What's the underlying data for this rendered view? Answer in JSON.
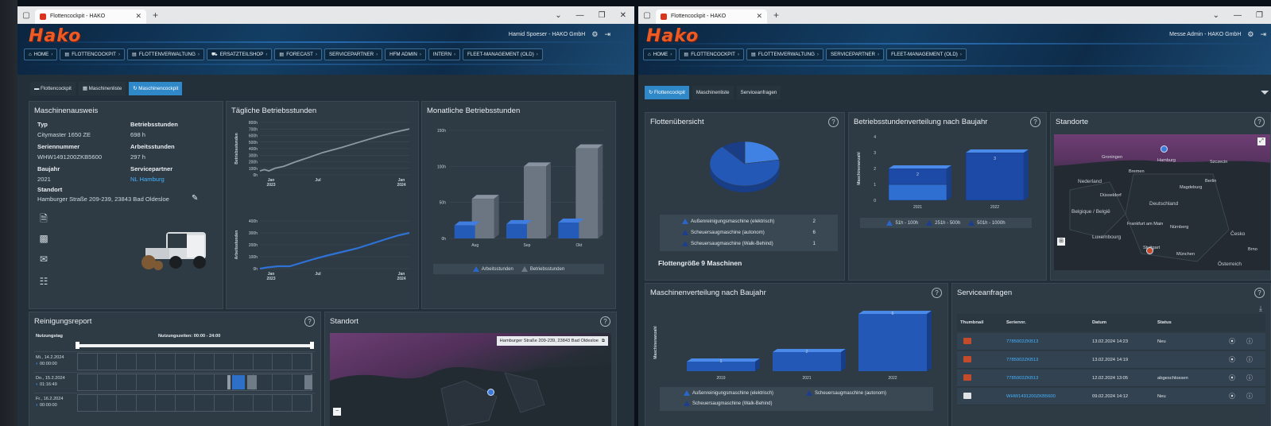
{
  "left": {
    "tab_title": "Flottencockpit - HAKO",
    "logo": "Hako",
    "user": "Hamid Spoeser - HAKO GmbH",
    "nav": [
      "HOME",
      "FLOTTENCOCKPIT",
      "FLOTTENVERWALTUNG",
      "ERSATZTEILSHOP",
      "FORECAST",
      "SERVICEPARTNER",
      "HFM ADMIN",
      "INTERN",
      "FLEET-MANAGEMENT (OLD)"
    ],
    "subtabs": [
      "Flottencockpit",
      "Maschinenliste",
      "Maschinencockpit"
    ],
    "ausweis": {
      "title": "Maschinenausweis",
      "typ_label": "Typ",
      "typ": "Citymaster 1650 ZE",
      "bs_label": "Betriebsstunden",
      "bs": "698 h",
      "sn_label": "Seriennummer",
      "sn": "WHW1491200ZKB5600",
      "as_label": "Arbeitsstunden",
      "as": "297 h",
      "bj_label": "Baujahr",
      "bj": "2021",
      "sp_label": "Servicepartner",
      "sp": "NL Hamburg",
      "st_label": "Standort",
      "st": "Hamburger Straße 209-239, 23843 Bad Oldesloe"
    },
    "taeglich": {
      "title": "Tägliche Betriebsstunden",
      "ylabel1": "Betriebsstunden",
      "ylabel2": "Arbeitsstunden",
      "xt": [
        "Jan\n2023",
        "Jul",
        "Jan\n2023",
        "Jul",
        "Jan\n2024"
      ]
    },
    "monatlich": {
      "title": "Monatliche Betriebsstunden",
      "legend": [
        "Arbeitsstunden",
        "Betriebsstunden"
      ]
    },
    "report": {
      "title": "Reinigungsreport",
      "col1": "Nutzungstag",
      "col2": "Nutzungszeiten: 00:00 - 24:00",
      "rows": [
        {
          "day": "Mi., 14.2.2024",
          "time": "00:00:00"
        },
        {
          "day": "Do., 15.2.2024",
          "time": "01:16:49"
        },
        {
          "day": "Fr., 16.2.2024",
          "time": "00:00:00"
        }
      ]
    },
    "standort": {
      "title": "Standort",
      "address": "Hamburger Straße 209-239, 23843 Bad Oldesloe"
    }
  },
  "right": {
    "tab_title": "Flottencockpit - HAKO",
    "logo": "Hako",
    "user": "Messe Admin - HAKO GmbH",
    "nav": [
      "HOME",
      "FLOTTENCOCKPIT",
      "FLOTTENVERWALTUNG",
      "SERVICEPARTNER",
      "FLEET-MANAGEMENT (OLD)"
    ],
    "subtabs": [
      "Flottencockpit",
      "Maschinenliste",
      "Serviceanfragen"
    ],
    "overview": {
      "title": "Flottenübersicht",
      "items": [
        {
          "label": "Außenreinigungsmaschine (elektrisch)",
          "count": "2"
        },
        {
          "label": "Scheuersaugmaschine (autonom)",
          "count": "6"
        },
        {
          "label": "Scheuersaugmaschine (Walk-Behind)",
          "count": "1"
        }
      ],
      "fleet_size": "Flottengröße 9 Maschinen"
    },
    "bsv": {
      "title": "Betriebsstundenverteilung nach Baujahr",
      "ylabel": "Maschinenanzahl",
      "legend": [
        "51h - 100h",
        "251h - 500h",
        "501h - 1000h"
      ]
    },
    "standorte": {
      "title": "Standorte"
    },
    "mvb": {
      "title": "Maschinenverteilung nach Baujahr",
      "ylabel": "Maschinenanzahl",
      "legend": [
        "Außenreinigungsmaschine (elektrisch)",
        "Scheuersaugmaschine (autonom)",
        "Scheuersaugmaschine (Walk-Behind)"
      ]
    },
    "service": {
      "title": "Serviceanfragen",
      "headers": [
        "Thumbnail",
        "Seriennr.",
        "Datum",
        "Status"
      ],
      "rows": [
        {
          "sn": "7785002ZKB13",
          "date": "13.02.2024 14:23",
          "status": "Neu"
        },
        {
          "sn": "7785002ZKB13",
          "date": "13.02.2024 14:19",
          "status": ""
        },
        {
          "sn": "7785002ZKB13",
          "date": "12.02.2024 13:05",
          "status": "abgeschlossen"
        },
        {
          "sn": "WHW1491200ZKB5600",
          "date": "09.02.2024 14:12",
          "status": "Neu"
        }
      ]
    },
    "map_labels": {
      "countries": [
        "Nederland",
        "Belgique / België",
        "Luxembourg",
        "Deutschland",
        "Česko",
        "Österreich"
      ],
      "cities": [
        "Groningen",
        "Hamburg",
        "Szczecin",
        "Bremen",
        "Berlin",
        "Magdeburg",
        "Düsseldorf",
        "Frankfurt am Main",
        "Nürnberg",
        "Stuttgart",
        "München",
        "Brno"
      ]
    }
  },
  "chart_data": [
    {
      "type": "line",
      "title": "Tägliche Betriebsstunden",
      "ylabel": "Betriebsstunden",
      "yticks": [
        "0h",
        "100h",
        "200h",
        "300h",
        "400h",
        "500h",
        "600h",
        "700h",
        "800h"
      ],
      "xticks": [
        "Jan 2023",
        "Jul",
        "Jan 2024"
      ],
      "ylim": [
        0,
        800
      ],
      "series": [
        {
          "name": "Betriebsstunden",
          "x": [
            0,
            0.03,
            0.06,
            0.1,
            0.16,
            0.24,
            0.32,
            0.42,
            0.55,
            0.68,
            0.8,
            0.9,
            1
          ],
          "y": [
            60,
            80,
            60,
            100,
            130,
            200,
            260,
            340,
            420,
            510,
            590,
            650,
            700
          ]
        }
      ]
    },
    {
      "type": "line",
      "ylabel": "Arbeitsstunden",
      "yticks": [
        "0h",
        "100h",
        "200h",
        "300h",
        "400h"
      ],
      "xticks": [
        "Jan 2023",
        "Jul",
        "Jan 2024"
      ],
      "ylim": [
        0,
        400
      ],
      "series": [
        {
          "name": "Arbeitsstunden",
          "x": [
            0,
            0.05,
            0.12,
            0.2,
            0.28,
            0.36,
            0.45,
            0.55,
            0.65,
            0.75,
            0.85,
            0.93,
            1
          ],
          "y": [
            0,
            10,
            20,
            20,
            50,
            80,
            110,
            140,
            170,
            210,
            250,
            280,
            300
          ]
        }
      ]
    },
    {
      "type": "bar",
      "title": "Monatliche Betriebsstunden",
      "categories": [
        "Aug",
        "Sep",
        "Okt"
      ],
      "yticks": [
        "0h",
        "50h",
        "100h",
        "150h"
      ],
      "ylim": [
        0,
        150
      ],
      "series": [
        {
          "name": "Arbeitsstunden",
          "values": [
            18,
            20,
            22
          ]
        },
        {
          "name": "Betriebsstunden",
          "values": [
            55,
            100,
            125
          ]
        }
      ]
    },
    {
      "type": "pie",
      "title": "Flottenübersicht",
      "categories": [
        "Außenreinigungsmaschine (elektrisch)",
        "Scheuersaugmaschine (autonom)",
        "Scheuersaugmaschine (Walk-Behind)"
      ],
      "values": [
        2,
        6,
        1
      ]
    },
    {
      "type": "bar",
      "title": "Betriebsstundenverteilung nach Baujahr",
      "ylabel": "Maschinenanzahl",
      "categories": [
        "2021",
        "2022"
      ],
      "yticks": [
        "0",
        "1",
        "2",
        "3",
        "4"
      ],
      "ylim": [
        0,
        4
      ],
      "series": [
        {
          "name": "51h - 100h",
          "values": [
            1,
            0
          ]
        },
        {
          "name": "251h - 500h",
          "values": [
            1,
            3
          ]
        },
        {
          "name": "501h - 1000h",
          "values": [
            0,
            0
          ]
        }
      ],
      "labels": [
        "2",
        "3"
      ]
    },
    {
      "type": "bar",
      "title": "Maschinenverteilung nach Baujahr",
      "ylabel": "Maschinenanzahl",
      "categories": [
        "2019",
        "2021",
        "2022"
      ],
      "values": [
        1,
        2,
        6
      ],
      "ylim": [
        0,
        6
      ]
    }
  ]
}
